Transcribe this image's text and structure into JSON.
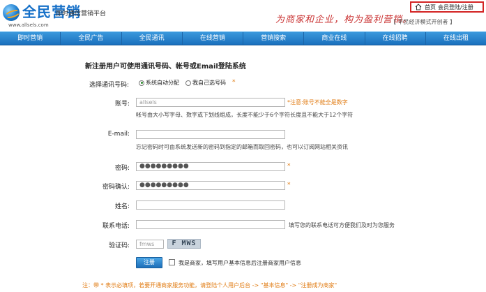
{
  "header": {
    "logo_text": "全民营销",
    "logo_sub": "即时通信营销平台",
    "logo_url": "www.allsels.com",
    "slogan": "为商家和企业，构为盈利营销。",
    "slogan_sub": "【 平民经济模式开创者 】",
    "links": [
      "首页",
      "会员登陆/注册"
    ]
  },
  "nav": [
    "即时营销",
    "全民广告",
    "全民通讯",
    "在线营销",
    "营销搜索",
    "商业在线",
    "在线招聘",
    "在线出租"
  ],
  "form": {
    "heading": "新注册用户可使用通讯号码、帐号或Email登陆系统",
    "select_label": "选择通讯号码:",
    "radio_auto": "系统自动分配",
    "radio_self": "我自己选号码",
    "star": "*",
    "account_label": "账号:",
    "account_value": "allsels",
    "account_warn": "*注意:账号不能全是数字",
    "account_hint": "帐号由大小写字母、数字或下划线组成，长度不能少于6个字符长度且不能大于12个字符",
    "email_label": "E-mail:",
    "email_hint": "忘记密码时可由系统发送新的密码到指定的邮箱而取回密码，也可以订阅网站相关资讯",
    "password_label": "密码:",
    "password_value": "●●●●●●●●●",
    "confirm_label": "密码确认:",
    "confirm_value": "●●●●●●●●●",
    "name_label": "姓名:",
    "phone_label": "联系电话:",
    "phone_hint": "填写您的联系电话可方便我们及时为您服务",
    "captcha_label": "验证码:",
    "captcha_value": "fmws",
    "captcha_image": "F MWS",
    "register_button": "注册",
    "merchant_label": "我是商家，填写用户基本信息后注册商家用户信息",
    "footnote": "注：带 * 表示必填项，若要开通商家服务功能，请登陆个人用户后台 -> \"基本信息\" -> \"注册成为商家\""
  }
}
